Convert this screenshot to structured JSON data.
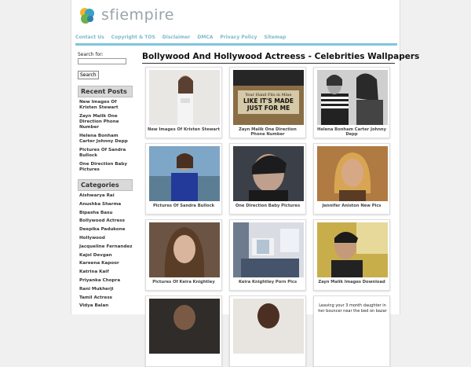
{
  "site": {
    "name": "sfiempire"
  },
  "nav": [
    "Contact Us",
    "Copyright & TOS",
    "Disclaimer",
    "DMCA",
    "Privacy Policy",
    "Sitemap"
  ],
  "search": {
    "label": "Search for:",
    "button": "Search"
  },
  "recent": {
    "title": "Recent Posts",
    "items": [
      "New Images Of Kristen Stewart",
      "Zayn Malik One Direction Phone Number",
      "Helena Bonham Carter Johnny Depp",
      "Pictures Of Sandra Bullock",
      "One Direction Baby Pictures"
    ]
  },
  "categories": {
    "title": "Categories",
    "items": [
      "Aishwarya Rai",
      "Anushka Sharma",
      "Bipasha Basu",
      "Bollywood Actress",
      "Deepika Padukone",
      "Hollywood",
      "Jacqueline Fernandez",
      "Kajol Devgan",
      "Kareena Kapoor",
      "Katrina Kaif",
      "Priyanka Chopra",
      "Rani Mukherji",
      "Tamil Actress",
      "Vidya Balan"
    ]
  },
  "main": {
    "title": "Bollywood And Hollywood Actreess - Celebrities Wallpapers",
    "tiles": [
      {
        "caption": "New Images Of Kristen Stewart",
        "overlay": ""
      },
      {
        "caption": "Zayn Malik One Direction Phone Number",
        "overlay": "Your Hand Fits in Mine LIKE IT'S MADE JUST FOR ME"
      },
      {
        "caption": "Helena Bonham Carter Johnny Depp",
        "overlay": ""
      },
      {
        "caption": "Pictures Of Sandra Bullock",
        "overlay": ""
      },
      {
        "caption": "One Direction Baby Pictures",
        "overlay": ""
      },
      {
        "caption": "Jennifer Aniston New Pics",
        "overlay": ""
      },
      {
        "caption": "Pictures Of Keira Knightley",
        "overlay": ""
      },
      {
        "caption": "Keira Knightley Porn Pics",
        "overlay": ""
      },
      {
        "caption": "Zayn Malik Images Download",
        "overlay": ""
      },
      {
        "caption": "",
        "overlay": ""
      },
      {
        "caption": "",
        "overlay": ""
      },
      {
        "caption": "",
        "overlay": "Leaving your 3 month daughter in her bouncer near the bed on bazar"
      }
    ]
  },
  "colors": {
    "nav": "#7fb9c9",
    "nav_line": "#7fc6de",
    "panel_bg": "#d9d9d9"
  }
}
